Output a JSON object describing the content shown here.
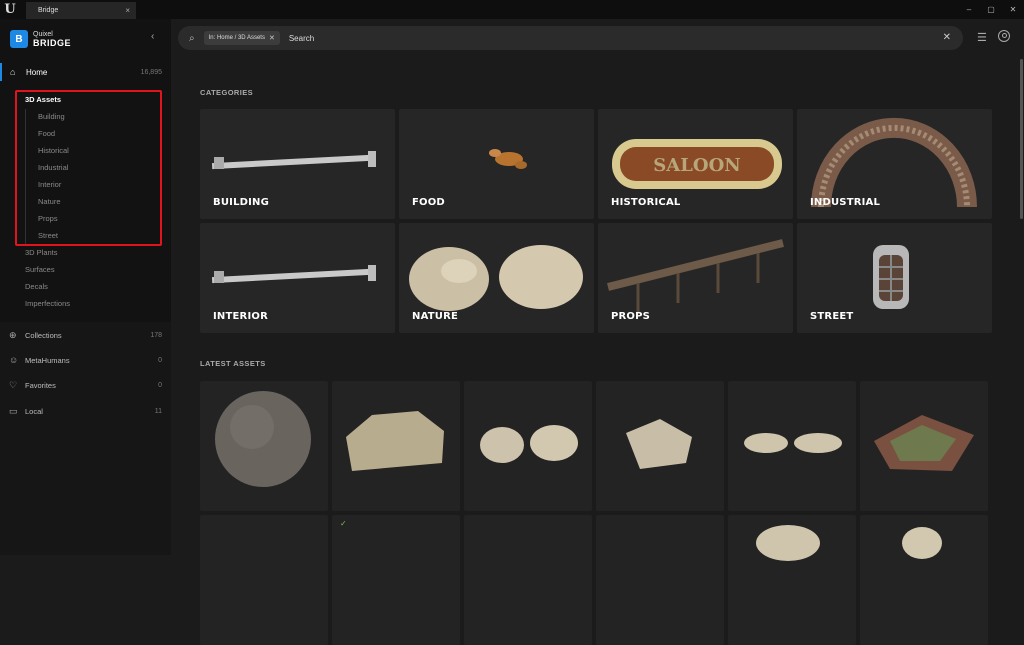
{
  "window": {
    "tab_title": "Bridge",
    "tab_close": "×",
    "controls": [
      "–",
      "▢",
      "✕"
    ]
  },
  "sidebar": {
    "brand_line1": "Quixel",
    "brand_line2": "BRIDGE",
    "collapse_glyph": "‹",
    "home": {
      "label": "Home",
      "count": "16,895"
    },
    "tree": {
      "parent": "3D Assets",
      "children": [
        "Building",
        "Food",
        "Historical",
        "Industrial",
        "Interior",
        "Nature",
        "Props",
        "Street"
      ],
      "siblings": [
        "3D Plants",
        "Surfaces",
        "Decals",
        "Imperfections"
      ]
    },
    "nav": [
      {
        "label": "Collections",
        "count": "178",
        "icon": "globe-icon"
      },
      {
        "label": "MetaHumans",
        "count": "0",
        "icon": "person-icon"
      },
      {
        "label": "Favorites",
        "count": "0",
        "icon": "heart-icon"
      },
      {
        "label": "Local",
        "count": "11",
        "icon": "monitor-icon"
      }
    ]
  },
  "search": {
    "chip": "In: Home / 3D Assets",
    "placeholder": "Search",
    "value": ""
  },
  "sections": {
    "categories": "CATEGORIES",
    "latest": "LATEST ASSETS"
  },
  "categories": [
    "BUILDING",
    "FOOD",
    "HISTORICAL",
    "INDUSTRIAL",
    "INTERIOR",
    "NATURE",
    "PROPS",
    "STREET"
  ],
  "historical_sign_text": "SALOON",
  "accent": "#1e88e5",
  "highlight_color": "#e0141e",
  "check_color": "#6fbf4a"
}
